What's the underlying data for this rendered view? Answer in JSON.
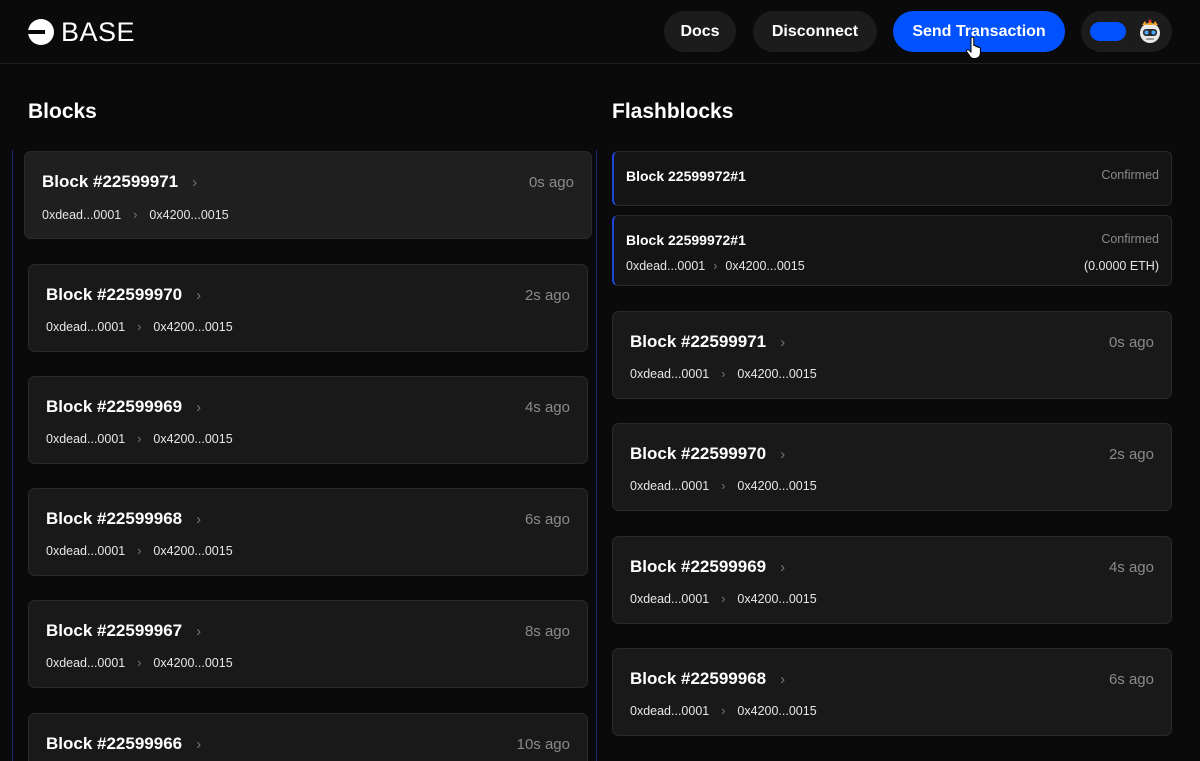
{
  "header": {
    "logo_text": "BASE",
    "docs_label": "Docs",
    "disconnect_label": "Disconnect",
    "send_label": "Send Transaction"
  },
  "blocks": {
    "title": "Blocks",
    "items": [
      {
        "title": "Block #22599971",
        "time": "0s ago",
        "from": "0xdead...0001",
        "to": "0x4200...0015"
      },
      {
        "title": "Block #22599970",
        "time": "2s ago",
        "from": "0xdead...0001",
        "to": "0x4200...0015"
      },
      {
        "title": "Block #22599969",
        "time": "4s ago",
        "from": "0xdead...0001",
        "to": "0x4200...0015"
      },
      {
        "title": "Block #22599968",
        "time": "6s ago",
        "from": "0xdead...0001",
        "to": "0x4200...0015"
      },
      {
        "title": "Block #22599967",
        "time": "8s ago",
        "from": "0xdead...0001",
        "to": "0x4200...0015"
      },
      {
        "title": "Block #22599966",
        "time": "10s ago",
        "from": "",
        "to": ""
      }
    ]
  },
  "flashblocks": {
    "title": "Flashblocks",
    "pending": [
      {
        "title": "Block 22599972#1",
        "status": "Confirmed"
      },
      {
        "title": "Block 22599972#1",
        "status": "Confirmed",
        "from": "0xdead...0001",
        "to": "0x4200...0015",
        "value": "(0.0000 ETH)"
      }
    ],
    "items": [
      {
        "title": "Block #22599971",
        "time": "0s ago",
        "from": "0xdead...0001",
        "to": "0x4200...0015"
      },
      {
        "title": "Block #22599970",
        "time": "2s ago",
        "from": "0xdead...0001",
        "to": "0x4200...0015"
      },
      {
        "title": "Block #22599969",
        "time": "4s ago",
        "from": "0xdead...0001",
        "to": "0x4200...0015"
      },
      {
        "title": "Block #22599968",
        "time": "6s ago",
        "from": "0xdead...0001",
        "to": "0x4200...0015"
      }
    ]
  },
  "colors": {
    "accent": "#0052ff",
    "card_bg": "#191919",
    "page_bg": "#0a0a0a"
  },
  "icons": {
    "chevron": "chevron-right-icon",
    "arrow": "arrow-right-icon",
    "cursor": "hand-cursor-icon",
    "avatar": "robot-avatar-icon"
  }
}
